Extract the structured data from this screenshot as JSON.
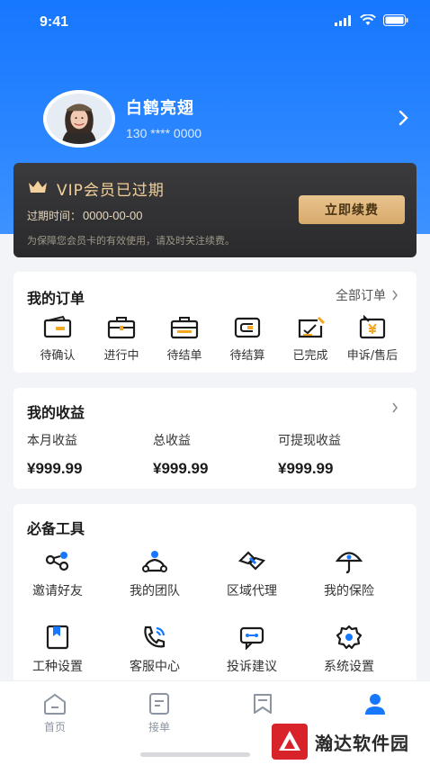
{
  "status_bar": {
    "time": "9:41"
  },
  "profile": {
    "name": "白鹤亮翅",
    "phone": "130 **** 0000"
  },
  "vip": {
    "title": "VIP会员已过期",
    "expire_label": "过期时间：",
    "expire_value": "0000-00-00",
    "note": "为保障您会员卡的有效使用，请及时关注续费。",
    "renew_label": "立即续费",
    "colors": {
      "gold": "#f2d19c",
      "button": "#e2b87c",
      "card": "#333335"
    }
  },
  "orders": {
    "title": "我的订单",
    "more_label": "全部订单",
    "items": [
      {
        "label": "待确认",
        "icon": "wallet-icon"
      },
      {
        "label": "进行中",
        "icon": "briefcase-icon"
      },
      {
        "label": "待结单",
        "icon": "briefcase-list-icon"
      },
      {
        "label": "待结算",
        "icon": "card-icon"
      },
      {
        "label": "已完成",
        "icon": "check-document-icon"
      },
      {
        "label": "申诉/售后",
        "icon": "yen-icon"
      }
    ]
  },
  "earnings": {
    "title": "我的收益",
    "items": [
      {
        "label": "本月收益",
        "value": "¥999.99"
      },
      {
        "label": "总收益",
        "value": "¥999.99"
      },
      {
        "label": "可提现收益",
        "value": "¥999.99"
      }
    ]
  },
  "tools": {
    "title": "必备工具",
    "items": [
      {
        "label": "邀请好友",
        "icon": "share-icon"
      },
      {
        "label": "我的团队",
        "icon": "team-icon"
      },
      {
        "label": "区域代理",
        "icon": "handshake-icon"
      },
      {
        "label": "我的保险",
        "icon": "umbrella-icon"
      },
      {
        "label": "工种设置",
        "icon": "bookmark-icon"
      },
      {
        "label": "客服中心",
        "icon": "phone-icon"
      },
      {
        "label": "投诉建议",
        "icon": "feedback-icon"
      },
      {
        "label": "系统设置",
        "icon": "gear-icon"
      }
    ]
  },
  "tabbar": {
    "items": [
      {
        "label": "首页",
        "icon": "home-icon"
      },
      {
        "label": "接单",
        "icon": "document-icon"
      },
      {
        "label": "",
        "icon": "bookmark-tab-icon"
      },
      {
        "label": "",
        "icon": "person-icon",
        "active": true
      }
    ],
    "active_color": "#1677ff"
  },
  "watermark": {
    "text": "瀚达软件园"
  },
  "colors": {
    "primary": "#1677ff",
    "accent": "#2f8bff"
  }
}
